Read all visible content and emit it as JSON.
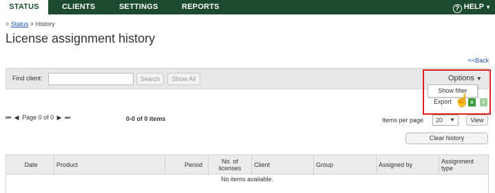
{
  "nav": {
    "tabs": [
      {
        "label": "STATUS",
        "active": true
      },
      {
        "label": "CLIENTS",
        "active": false
      },
      {
        "label": "SETTINGS",
        "active": false
      },
      {
        "label": "REPORTS",
        "active": false
      }
    ],
    "help_label": "HELP",
    "help_icon": "question-circle-icon",
    "colors": {
      "bar": "#1b4a2e",
      "active_tab_bg": "#ffffff"
    }
  },
  "breadcrumb": {
    "prefix": ">",
    "link": "Status",
    "separator": ">",
    "current": "History"
  },
  "page_title": "License assignment history",
  "back_link": "<<Back",
  "filter": {
    "find_label": "Find client:",
    "find_value": "",
    "search_label": "Search",
    "showall_label": "Show All"
  },
  "options": {
    "label": "Options",
    "menu_item": "Show filter",
    "export_label": "Export",
    "highlight_color": "#e11d1d"
  },
  "pager": {
    "first": "⏮",
    "prev": "◀",
    "text": "Page 0 of 0",
    "next": "▶",
    "last": "⏭",
    "items_text": "0-0 of 0 items"
  },
  "per_page": {
    "label": "Items per page",
    "value": "20",
    "view_label": "View"
  },
  "clear_history_label": "Clear history",
  "table": {
    "columns": [
      "Date",
      "Product",
      "Period",
      "No. of licenses",
      "Client",
      "Group",
      "Assigned by",
      "Assignment type"
    ],
    "empty_text": "No items available."
  }
}
